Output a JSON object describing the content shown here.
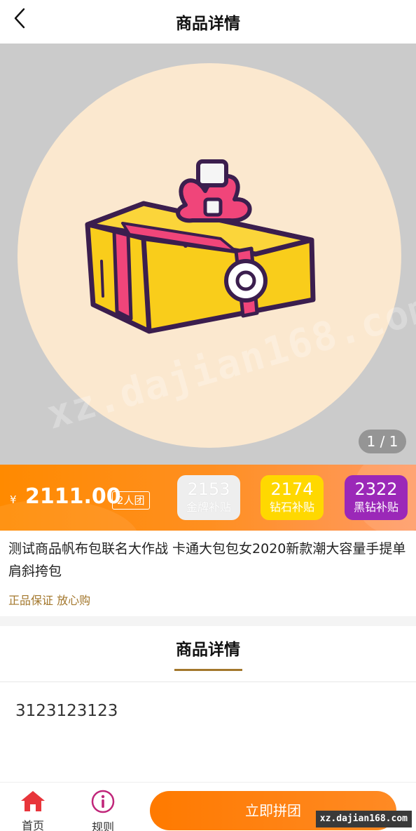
{
  "nav": {
    "title": "商品详情",
    "back_icon": "chevron-left-icon"
  },
  "gallery": {
    "counter": "1 / 1",
    "watermark": "xz.dajian168.com",
    "image": "gift-box-illustration",
    "colors": {
      "background": "#cbcbcb",
      "circle": "#fbe8cf",
      "box": "#f9cd1b",
      "ribbon": "#f0457a",
      "outline": "#3b1e4e"
    }
  },
  "price_bar": {
    "currency": "¥",
    "price": "2111.00",
    "group_tag": "2人团",
    "subsidies": [
      {
        "value": "2153",
        "label": "金牌补贴",
        "color": "#eeeeee"
      },
      {
        "value": "2174",
        "label": "钻石补贴",
        "color": "#ffd800"
      },
      {
        "value": "2322",
        "label": "黑钻补贴",
        "color": "#9b28b8"
      }
    ]
  },
  "product": {
    "title": "测试商品帆布包联名大作战 卡通大包包女2020新款潮大容量手提单肩斜挎包",
    "guarantee": "正品保证 放心购"
  },
  "detail": {
    "tab_label": "商品详情",
    "content": "3123123123"
  },
  "bottom_bar": {
    "home_label": "首页",
    "rules_label": "规则",
    "buy_label": "立即拼团",
    "home_icon": "home-icon",
    "rules_icon": "info-circle-icon"
  },
  "site_badge": "xz.dajian168.com",
  "colors": {
    "accent": "#ff8a00",
    "gold_text": "#a3772c",
    "red_icon": "#e8353b",
    "purple_icon": "#c0267a"
  }
}
